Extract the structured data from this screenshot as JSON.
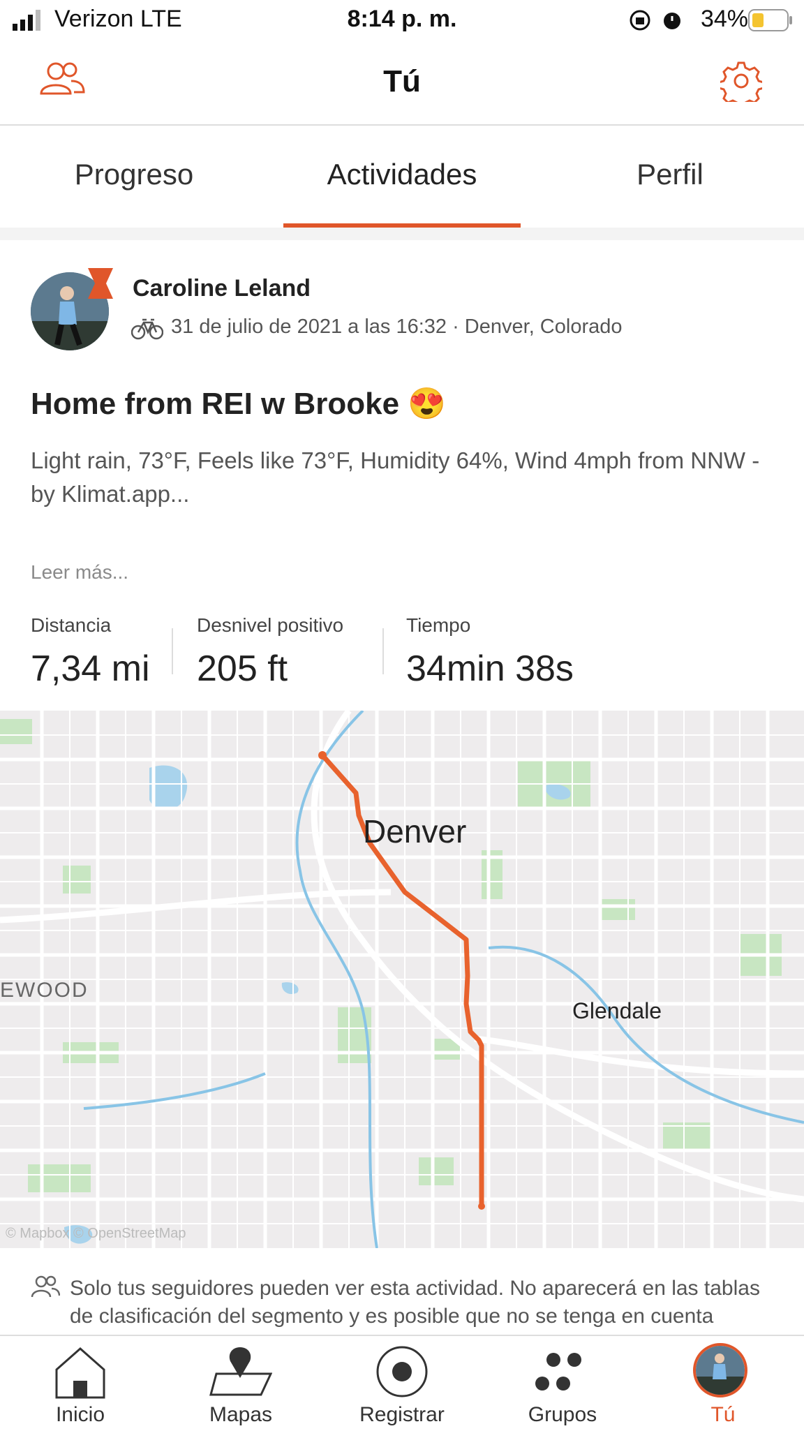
{
  "status_bar": {
    "carrier": "Verizon  LTE",
    "time": "8:14 p. m.",
    "battery": "34%"
  },
  "header": {
    "title": "Tú",
    "left_icon": "athletes-icon",
    "right_icon": "settings-gear-icon",
    "accent": "#e0562a"
  },
  "tabs": [
    {
      "label": "Progreso",
      "active": false
    },
    {
      "label": "Actividades",
      "active": true
    },
    {
      "label": "Perfil",
      "active": false
    }
  ],
  "activity": {
    "athlete_name": "Caroline Leland",
    "date_location": "31 de julio de 2021 a las 16:32 · Denver, Colorado",
    "sport_icon": "bike-icon",
    "title": "Home from REI w Brooke 😍",
    "description": "Light rain, 73°F, Feels like 73°F, Humidity 64%, Wind 4mph from NNW - by Klimat.app...",
    "read_more": "Leer más...",
    "stats": [
      {
        "label": "Distancia",
        "value": "7,34 mi"
      },
      {
        "label": "Desnivel positivo",
        "value": "205 ft"
      },
      {
        "label": "Tiempo",
        "value": "34min 38s"
      }
    ]
  },
  "map": {
    "labels": {
      "city": "Denver",
      "town": "Glendale",
      "edge": "EWOOD"
    },
    "attribution": "© Mapbox © OpenStreetMap",
    "route_color": "#e8622d"
  },
  "privacy_note": "Solo tus seguidores pueden ver esta actividad. No aparecerá en las tablas de clasificación del segmento y es posible que no se tenga en cuenta",
  "nav": [
    {
      "label": "Inicio",
      "icon": "home-icon",
      "active": false
    },
    {
      "label": "Mapas",
      "icon": "map-pin-icon",
      "active": false
    },
    {
      "label": "Registrar",
      "icon": "record-icon",
      "active": false
    },
    {
      "label": "Grupos",
      "icon": "groups-icon",
      "active": false
    },
    {
      "label": "Tú",
      "icon": "avatar-icon",
      "active": true
    }
  ]
}
